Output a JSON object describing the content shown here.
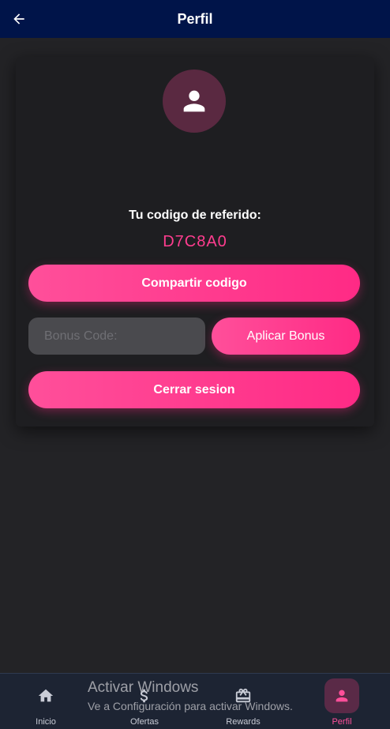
{
  "appbar": {
    "title": "Perfil",
    "back_icon": "arrow-left-icon"
  },
  "profile": {
    "avatar_icon": "person-icon",
    "referral_label": "Tu codigo de referido:",
    "referral_code": "D7C8A0"
  },
  "actions": {
    "share_label": "Compartir codigo",
    "bonus_placeholder": "Bonus Code:",
    "bonus_value": "",
    "apply_label": "Aplicar Bonus",
    "logout_label": "Cerrar sesion"
  },
  "bottom_nav": {
    "items": [
      {
        "label": "Inicio",
        "icon": "home-icon"
      },
      {
        "label": "Ofertas",
        "icon": "dollar-icon"
      },
      {
        "label": "Rewards",
        "icon": "gift-icon"
      },
      {
        "label": "Perfil",
        "icon": "person-icon",
        "active": true
      }
    ]
  },
  "watermark": {
    "title": "Activar Windows",
    "subtitle": "Ve a Configuración para activar Windows."
  },
  "colors": {
    "accent": "#ff3d8f",
    "appbar": "#001449",
    "background": "#232326",
    "card": "#1e1e21",
    "bottom_nav": "#1d2433"
  }
}
